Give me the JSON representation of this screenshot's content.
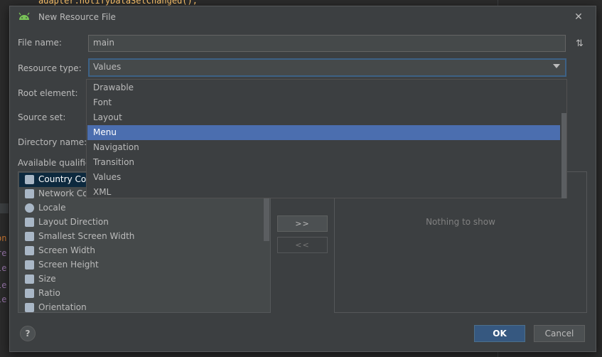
{
  "background": {
    "code_top": "adapter.notifyDataSetChanged();",
    "left_fragments": [
      "on",
      "re",
      "le",
      "le",
      "le"
    ]
  },
  "dialog": {
    "title": "New Resource File",
    "file_name_label": "File name:",
    "file_name_value": "main",
    "resource_type_label": "Resource type:",
    "resource_type_value": "Values",
    "root_element_label": "Root element:",
    "source_set_label": "Source set:",
    "directory_name_label": "Directory name:",
    "available_qualifiers_label": "Available qualifiers:",
    "dropdown_options": [
      "Drawable",
      "Font",
      "Layout",
      "Menu",
      "Navigation",
      "Transition",
      "Values",
      "XML"
    ],
    "dropdown_selected": "Menu",
    "qualifiers": [
      {
        "label": "Country Code",
        "icon": "country-code-icon"
      },
      {
        "label": "Network Code",
        "icon": "network-code-icon"
      },
      {
        "label": "Locale",
        "icon": "globe-icon"
      },
      {
        "label": "Layout Direction",
        "icon": "layout-direction-icon"
      },
      {
        "label": "Smallest Screen Width",
        "icon": "smallest-width-icon"
      },
      {
        "label": "Screen Width",
        "icon": "screen-width-icon"
      },
      {
        "label": "Screen Height",
        "icon": "screen-height-icon"
      },
      {
        "label": "Size",
        "icon": "size-icon"
      },
      {
        "label": "Ratio",
        "icon": "ratio-icon"
      },
      {
        "label": "Orientation",
        "icon": "orientation-icon"
      }
    ],
    "add_button": ">>",
    "remove_button": "<<",
    "chosen_empty_text": "Nothing to show",
    "help_button": "?",
    "ok_button": "OK",
    "cancel_button": "Cancel",
    "close_button": "✕",
    "sort_icon": "⇅"
  },
  "colors": {
    "accent": "#4b6eaf",
    "ok": "#365880"
  }
}
